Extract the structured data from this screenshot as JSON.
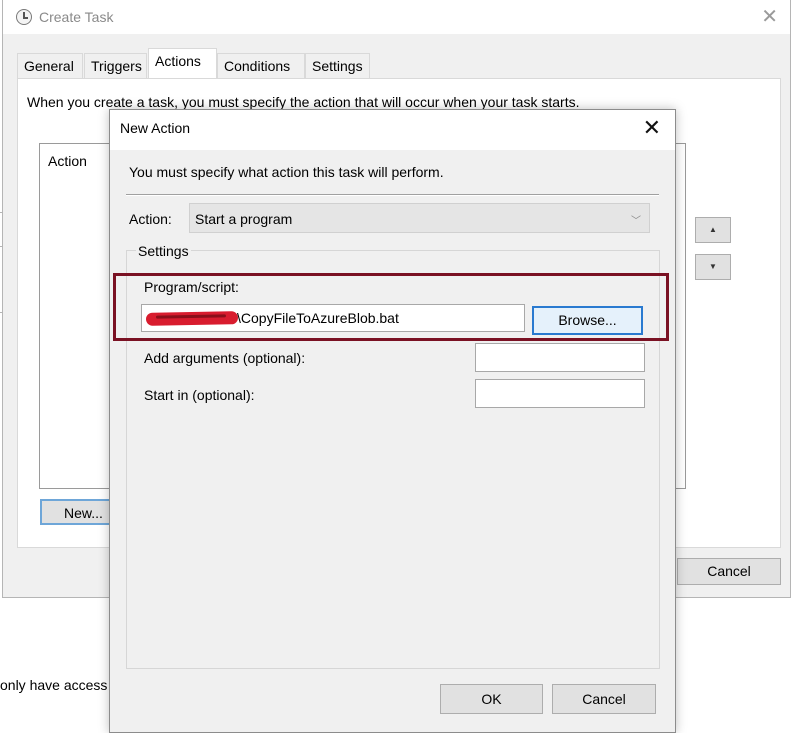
{
  "create_task": {
    "title": "Create Task",
    "tabs": [
      "General",
      "Triggers",
      "Actions",
      "Conditions",
      "Settings"
    ],
    "active_tab": "Actions",
    "actions_description": "When you create a task, you must specify the action that will occur when your task starts.",
    "list_column_header": "Action",
    "new_button": "New...",
    "cancel_button": "Cancel"
  },
  "behind_text": "only have access t",
  "new_action": {
    "title": "New Action",
    "description": "You must specify what action this task will perform.",
    "action_label": "Action:",
    "action_value": "Start a program",
    "settings_label": "Settings",
    "program_label": "Program/script:",
    "program_value_visible": "\\CopyFileToAzureBlob.bat",
    "browse_button": "Browse...",
    "arguments_label": "Add arguments (optional):",
    "arguments_value": "",
    "start_in_label": "Start in (optional):",
    "start_in_value": "",
    "ok_button": "OK",
    "cancel_button": "Cancel"
  },
  "icons": {
    "app_icon": "clock-icon",
    "close": "close-icon",
    "dropdown": "chevron-down-icon",
    "move_up": "triangle-up-icon",
    "move_down": "triangle-down-icon"
  },
  "colors": {
    "highlight_border": "#7a1123",
    "redaction": "#d81c2e",
    "focus_blue": "#2a7ad0"
  }
}
